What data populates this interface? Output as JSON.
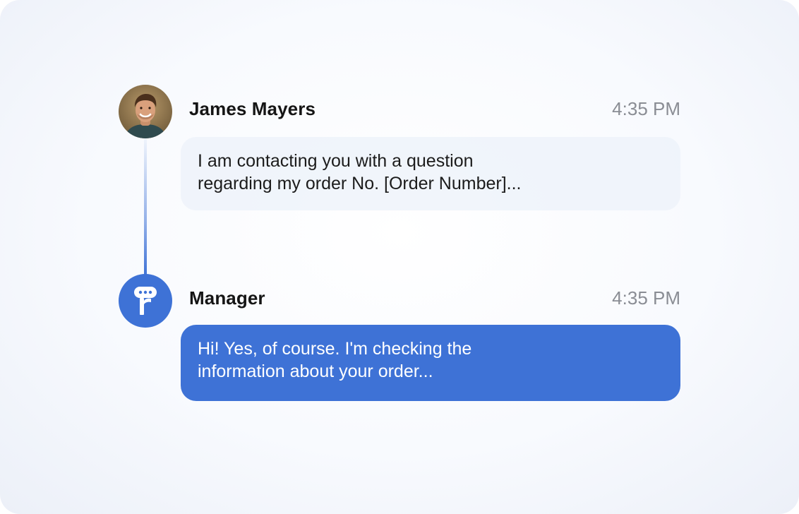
{
  "messages": [
    {
      "sender": "James Mayers",
      "time": "4:35 PM",
      "lines": [
        "I am contacting you with a question",
        "regarding my order No. [Order Number]..."
      ]
    },
    {
      "sender": "Manager",
      "time": "4:35 PM",
      "lines": [
        "Hi! Yes, of course. I'm checking the",
        "information about your order..."
      ]
    }
  ],
  "colors": {
    "accent": "#3e72d6",
    "timestamp": "#8a8d94",
    "user_bubble": "#ecf1fa"
  },
  "icons": {
    "user_avatar": "user-photo-avatar",
    "manager_avatar": "brand-logo-icon"
  }
}
